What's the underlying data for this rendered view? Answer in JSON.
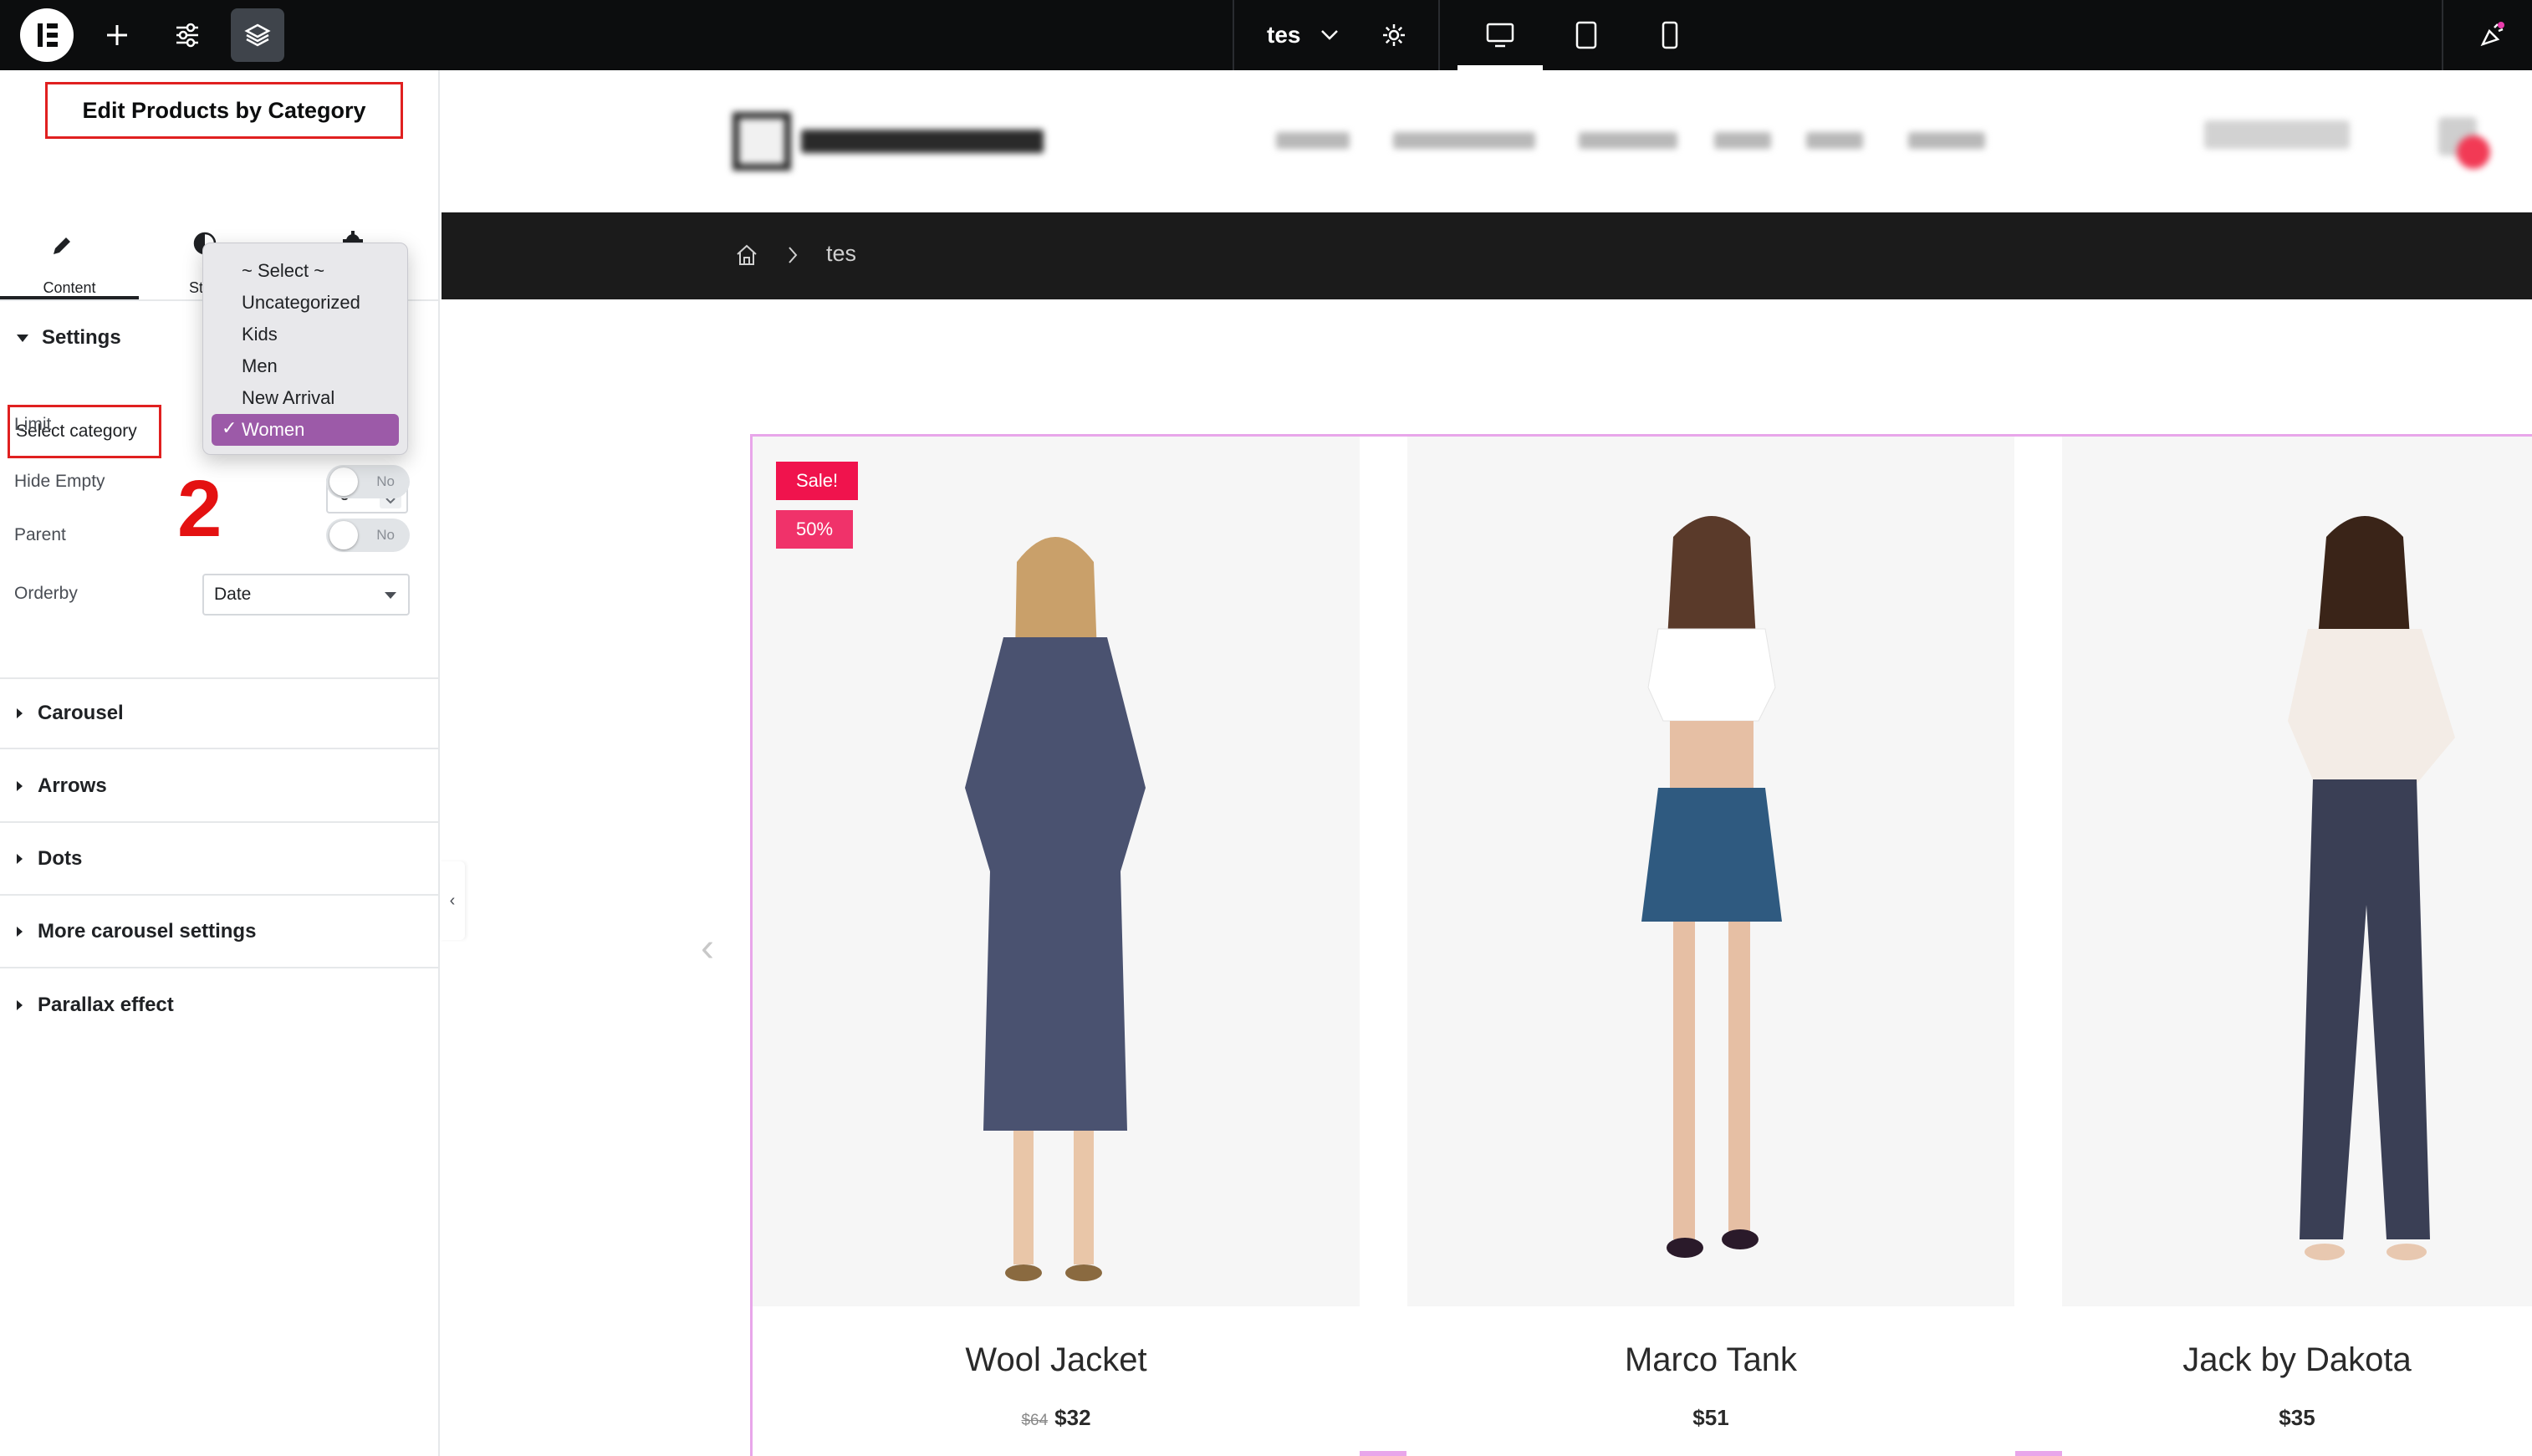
{
  "topbar": {
    "page_name": "tes",
    "icons": [
      "elementor-logo",
      "add-icon",
      "sliders-icon",
      "layers-icon",
      "chevron-down-icon",
      "gear-icon",
      "desktop-icon",
      "tablet-icon",
      "mobile-icon",
      "notification-icon"
    ],
    "accent": "#e93cac"
  },
  "panel": {
    "title": "Edit Products by Category",
    "tabs": [
      {
        "label": "Content",
        "icon": "pencil-icon"
      },
      {
        "label": "St",
        "icon": "style-icon"
      },
      {
        "label": "",
        "icon": "settings-icon"
      }
    ],
    "settings_section": "Settings",
    "select_category_label": "Select category",
    "annotation_number": "2",
    "limit_label": "Limit",
    "limit_value": "6",
    "hide_empty_label": "Hide Empty",
    "hide_empty_value": "No",
    "parent_label": "Parent",
    "parent_value": "No",
    "orderby_label": "Orderby",
    "orderby_value": "Date",
    "dropdown": [
      "~ Select ~",
      "Uncategorized",
      "Kids",
      "Men",
      "New Arrival",
      "Women"
    ],
    "dropdown_selected": "Women",
    "dropdown_selected_color": "#9c5aa8",
    "sections": [
      "Carousel",
      "Arrows",
      "Dots",
      "More carousel settings",
      "Parallax effect"
    ]
  },
  "site": {
    "breadcrumb": "tes",
    "products": [
      {
        "title": "Wool Jacket",
        "old_price": "$64",
        "price": "$32",
        "badges": [
          "Sale!",
          "50%"
        ]
      },
      {
        "title": "Marco Tank",
        "old_price": "",
        "price": "$51",
        "badges": []
      },
      {
        "title": "Jack by Dakota",
        "old_price": "",
        "price": "$35",
        "badges": []
      }
    ],
    "sale_color": "#f0134d",
    "highlight_color": "#e8a6ea"
  }
}
